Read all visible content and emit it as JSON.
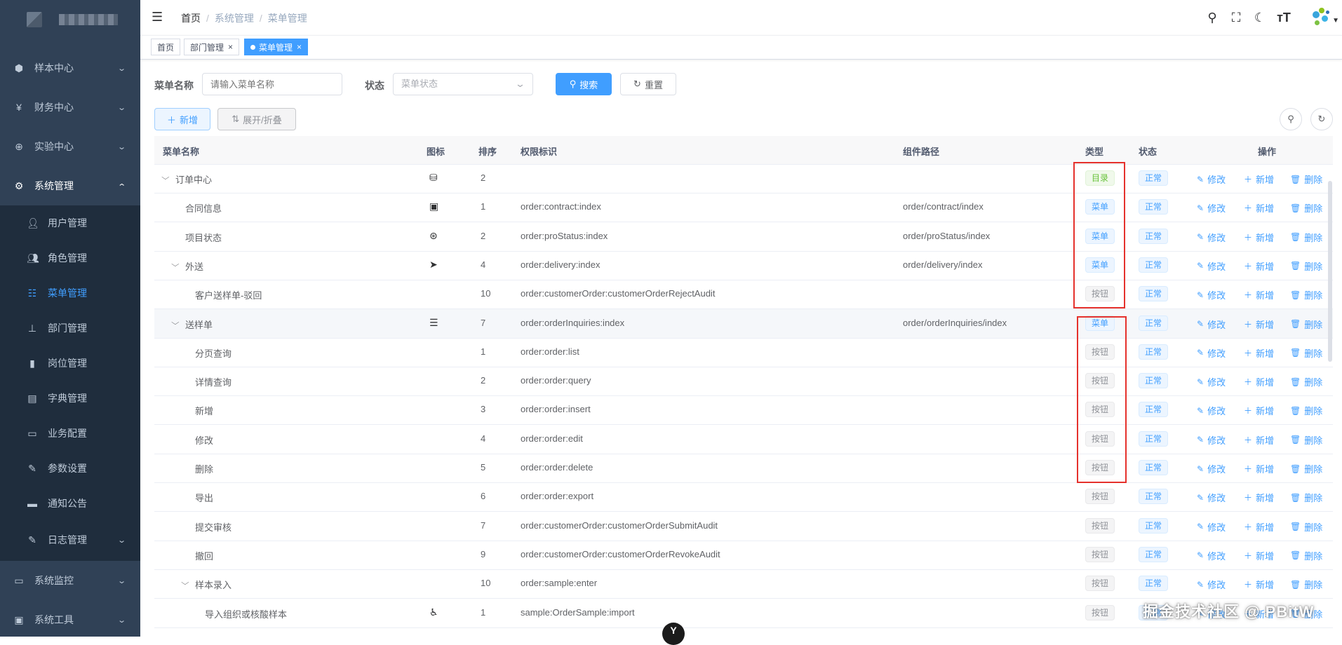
{
  "sidebar": {
    "top_menus": [
      {
        "label": "样本中心",
        "icon": "cube-icon"
      },
      {
        "label": "财务中心",
        "icon": "yen-icon"
      },
      {
        "label": "实验中心",
        "icon": "target-icon"
      },
      {
        "label": "系统管理",
        "icon": "gear-icon"
      }
    ],
    "sub_items": [
      {
        "label": "用户管理",
        "icon": "user-icon"
      },
      {
        "label": "角色管理",
        "icon": "peoples-icon"
      },
      {
        "label": "菜单管理",
        "icon": "tree-table-icon"
      },
      {
        "label": "部门管理",
        "icon": "tree-icon"
      },
      {
        "label": "岗位管理",
        "icon": "post-icon"
      },
      {
        "label": "字典管理",
        "icon": "dict-icon"
      },
      {
        "label": "业务配置",
        "icon": "monitor-icon"
      },
      {
        "label": "参数设置",
        "icon": "edit-icon"
      },
      {
        "label": "通知公告",
        "icon": "message-icon"
      },
      {
        "label": "日志管理",
        "icon": "log-icon"
      }
    ],
    "bottom_menus": [
      {
        "label": "系统监控",
        "icon": "monitor-icon"
      },
      {
        "label": "系统工具",
        "icon": "toolbox-icon"
      }
    ]
  },
  "breadcrumb": {
    "home": "首页",
    "level1": "系统管理",
    "level2": "菜单管理",
    "sep": "/"
  },
  "tags": [
    {
      "label": "首页"
    },
    {
      "label": "部门管理"
    },
    {
      "label": "菜单管理"
    }
  ],
  "search": {
    "name_label": "菜单名称",
    "name_placeholder": "请输入菜单名称",
    "status_label": "状态",
    "status_placeholder": "菜单状态",
    "search_btn": "搜索",
    "reset_btn": "重置"
  },
  "toolbar": {
    "add_btn": "新增",
    "expand_btn": "展开/折叠"
  },
  "columns": {
    "name": "菜单名称",
    "icon": "图标",
    "order": "排序",
    "perms": "权限标识",
    "component": "组件路径",
    "type": "类型",
    "status": "状态",
    "ops": "操作"
  },
  "ops": {
    "edit": "修改",
    "add": "新增",
    "delete": "删除"
  },
  "rows": [
    {
      "name": "订单中心",
      "caret": "⌵",
      "icon": "⛁",
      "order": "2",
      "perms": "",
      "component": "",
      "type": "目录",
      "type_style": "success",
      "status": "正常"
    },
    {
      "name": "合同信息",
      "caret": "",
      "icon": "▣",
      "order": "1",
      "perms": "order:contract:index",
      "component": "order/contract/index",
      "type": "菜单",
      "type_style": "primary",
      "status": "正常"
    },
    {
      "name": "项目状态",
      "caret": "",
      "icon": "⊛",
      "order": "2",
      "perms": "order:proStatus:index",
      "component": "order/proStatus/index",
      "type": "菜单",
      "type_style": "primary",
      "status": "正常"
    },
    {
      "name": "外送",
      "caret": "⌵",
      "icon": "➤",
      "order": "4",
      "perms": "order:delivery:index",
      "component": "order/delivery/index",
      "type": "菜单",
      "type_style": "primary",
      "status": "正常"
    },
    {
      "name": "客户送样单-驳回",
      "caret": "",
      "icon": "",
      "order": "10",
      "perms": "order:customerOrder:customerOrderRejectAudit",
      "component": "",
      "type": "按钮",
      "type_style": "info",
      "status": "正常"
    },
    {
      "name": "送样单",
      "caret": "⌵",
      "icon": "☰",
      "order": "7",
      "perms": "order:orderInquiries:index",
      "component": "order/orderInquiries/index",
      "type": "菜单",
      "type_style": "primary",
      "status": "正常"
    },
    {
      "name": "分页查询",
      "caret": "",
      "icon": "",
      "order": "1",
      "perms": "order:order:list",
      "component": "",
      "type": "按钮",
      "type_style": "info",
      "status": "正常"
    },
    {
      "name": "详情查询",
      "caret": "",
      "icon": "",
      "order": "2",
      "perms": "order:order:query",
      "component": "",
      "type": "按钮",
      "type_style": "info",
      "status": "正常"
    },
    {
      "name": "新增",
      "caret": "",
      "icon": "",
      "order": "3",
      "perms": "order:order:insert",
      "component": "",
      "type": "按钮",
      "type_style": "info",
      "status": "正常"
    },
    {
      "name": "修改",
      "caret": "",
      "icon": "",
      "order": "4",
      "perms": "order:order:edit",
      "component": "",
      "type": "按钮",
      "type_style": "info",
      "status": "正常"
    },
    {
      "name": "删除",
      "caret": "",
      "icon": "",
      "order": "5",
      "perms": "order:order:delete",
      "component": "",
      "type": "按钮",
      "type_style": "info",
      "status": "正常"
    },
    {
      "name": "导出",
      "caret": "",
      "icon": "",
      "order": "6",
      "perms": "order:order:export",
      "component": "",
      "type": "按钮",
      "type_style": "info",
      "status": "正常"
    },
    {
      "name": "提交审核",
      "caret": "",
      "icon": "",
      "order": "7",
      "perms": "order:customerOrder:customerOrderSubmitAudit",
      "component": "",
      "type": "按钮",
      "type_style": "info",
      "status": "正常"
    },
    {
      "name": "撤回",
      "caret": "",
      "icon": "",
      "order": "9",
      "perms": "order:customerOrder:customerOrderRevokeAudit",
      "component": "",
      "type": "按钮",
      "type_style": "info",
      "status": "正常"
    },
    {
      "name": "样本录入",
      "caret": "⌵",
      "icon": "",
      "order": "10",
      "perms": "order:sample:enter",
      "component": "",
      "type": "按钮",
      "type_style": "info",
      "status": "正常"
    },
    {
      "name": "导入组织或核酸样本",
      "caret": "",
      "icon": "♿",
      "order": "1",
      "perms": "sample:OrderSample:import",
      "component": "",
      "type": "按钮",
      "type_style": "info",
      "status": "正常"
    }
  ],
  "watermark": "掘金技术社区 @ PBitW",
  "bottom_badge": "Y"
}
